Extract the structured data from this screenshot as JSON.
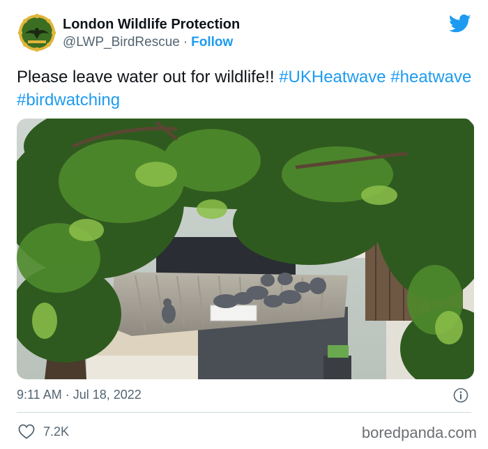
{
  "account": {
    "display_name": "London Wildlife Protection",
    "handle": "@LWP_BirdRescue",
    "separator": "·",
    "follow_label": "Follow",
    "avatar_icon": "wildlife-emblem-icon"
  },
  "tweet": {
    "text": "Please leave water out for wildlife!!",
    "hashtags": [
      "#UKHeatwave",
      "#heatwave",
      "#birdwatching"
    ],
    "timestamp": "9:11 AM · Jul 18, 2022",
    "like_count": "7.2K"
  },
  "icons": {
    "platform": "twitter-bird-icon",
    "info": "info-icon",
    "like": "heart-icon"
  },
  "watermark": "boredpanda.com",
  "colors": {
    "accent": "#1d9bf0",
    "text": "#0f1419",
    "muted": "#536471",
    "divider": "#cfd9de",
    "avatar_green": "#3b6e22",
    "avatar_gold": "#e0b53a"
  }
}
